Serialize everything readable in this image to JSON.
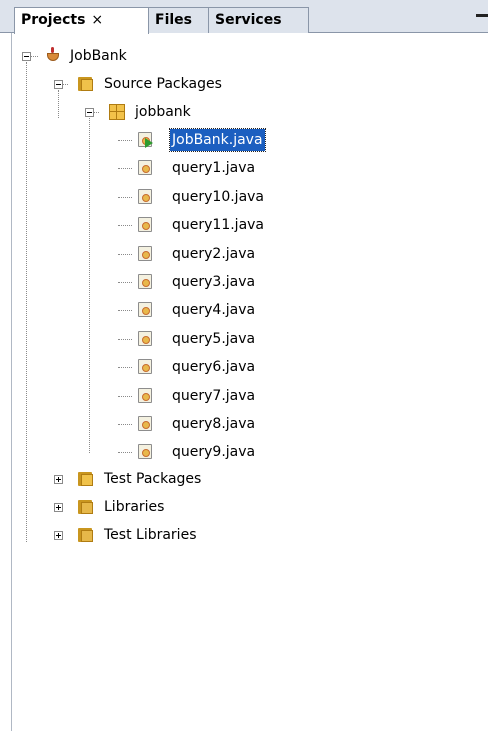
{
  "tabs": [
    {
      "label": "Projects",
      "close": "×",
      "active": true
    },
    {
      "label": "Files",
      "active": false
    },
    {
      "label": "Services",
      "active": false
    }
  ],
  "tree": {
    "project": "JobBank",
    "source_packages": "Source Packages",
    "package": "jobbank",
    "files": [
      "JobBank.java",
      "query1.java",
      "query10.java",
      "query11.java",
      "query2.java",
      "query3.java",
      "query4.java",
      "query5.java",
      "query6.java",
      "query7.java",
      "query8.java",
      "query9.java"
    ],
    "test_packages": "Test Packages",
    "libraries": "Libraries",
    "test_libraries": "Test Libraries"
  },
  "icons": {
    "project": "coffee-cup-icon",
    "source_packages": "folder-icon",
    "package": "package-icon",
    "file": "java-file-icon",
    "main_file": "java-main-file-icon",
    "libraries": "library-folder-icon"
  },
  "colors": {
    "selection": "#1c5fc0",
    "tabbar": "#dde3ec"
  }
}
